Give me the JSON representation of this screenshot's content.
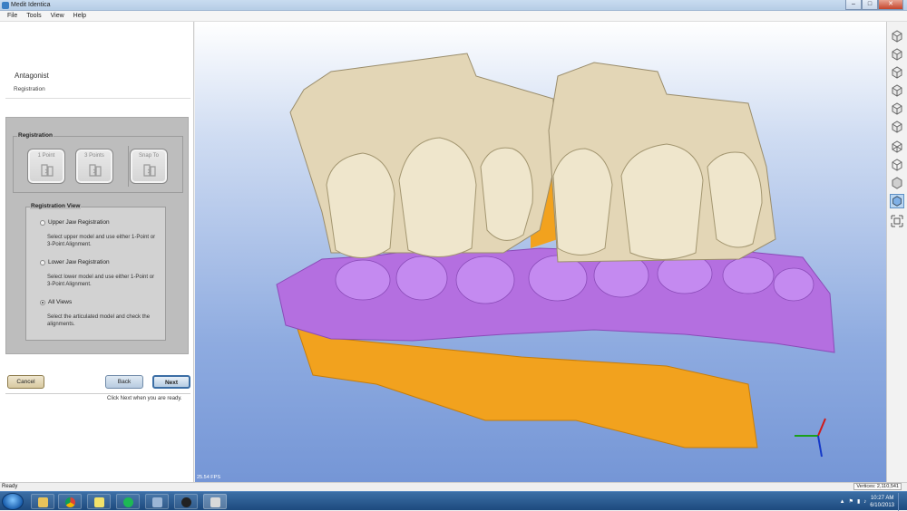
{
  "window": {
    "title": "Medit Identica"
  },
  "menu": [
    "File",
    "Tools",
    "View",
    "Help"
  ],
  "left_panel": {
    "title": "Antagonist",
    "subtitle": "Registration",
    "registration": {
      "legend": "Registration",
      "buttons": [
        "1 Point",
        "3 Points",
        "Snap To"
      ]
    },
    "registration_view": {
      "legend": "Registration View",
      "options": [
        {
          "label": "Upper Jaw Registration",
          "description": "Select upper model and use either 1-Point or 3-Point Alignment.",
          "selected": false
        },
        {
          "label": "Lower Jaw Registration",
          "description": "Select lower model and use either 1-Point or 3-Point Alignment.",
          "selected": false
        },
        {
          "label": "All Views",
          "description": "Select the articulated model and check the alignments.",
          "selected": true
        }
      ]
    },
    "buttons": {
      "cancel": "Cancel",
      "back": "Back",
      "next": "Next"
    },
    "hint": "Click Next when you are ready."
  },
  "viewport": {
    "fps": "25.54 FPS"
  },
  "status": {
    "left": "Ready",
    "right": "Vertices: 2,110,541"
  },
  "taskbar": {
    "time": "10:27 AM",
    "date": "6/10/2013"
  },
  "colors": {
    "upper_jaw": "#e3d6b6",
    "lower_gum": "#b46fe0",
    "lower_base": "#f2a21e",
    "bg_top": "#ffffff",
    "bg_bottom": "#7596d6"
  }
}
